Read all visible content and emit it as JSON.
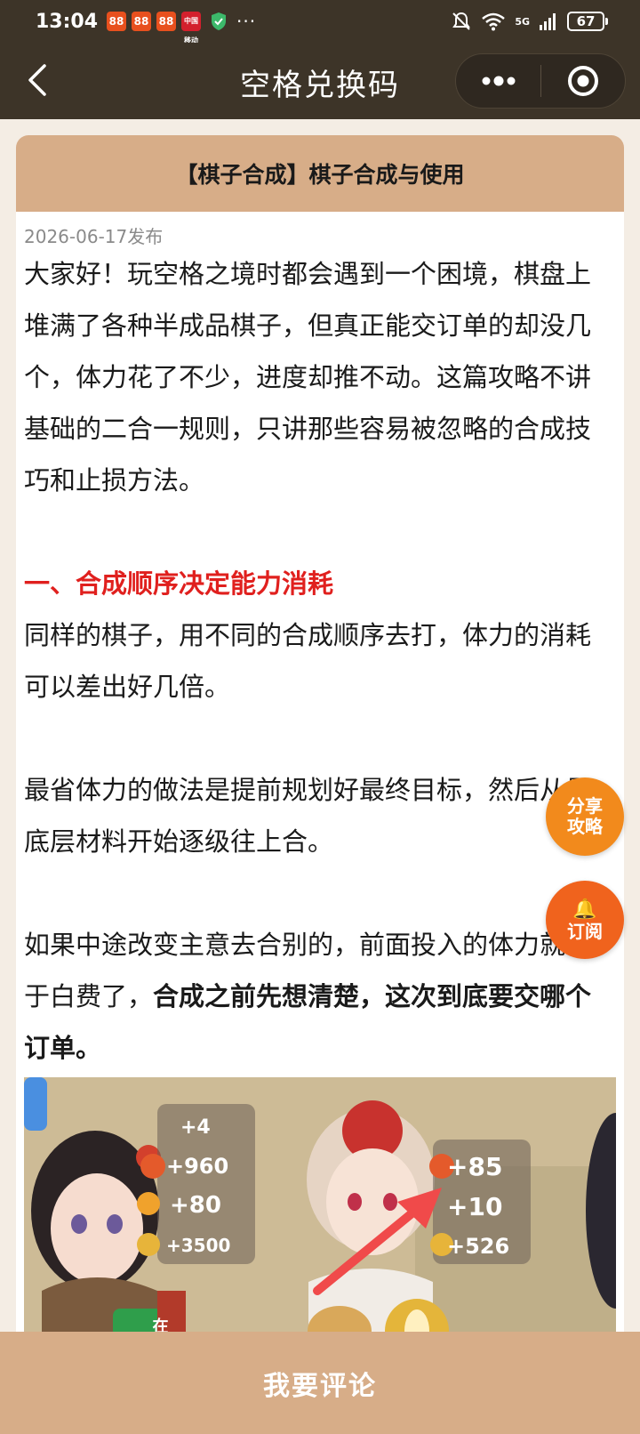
{
  "status_bar": {
    "time": "13:04",
    "app_icons": [
      "88",
      "88",
      "88",
      "中国移动"
    ],
    "more": "···",
    "network": "5G",
    "battery": "67"
  },
  "nav": {
    "title": "空格兑换码",
    "more_icon": "more-dots-icon",
    "close_icon": "target-close-icon"
  },
  "article": {
    "header": "【棋子合成】棋子合成与使用",
    "publish_date": "2026-06-17发布",
    "intro": "大家好！玩空格之境时都会遇到一个困境，棋盘上堆满了各种半成品棋子，但真正能交订单的却没几个，体力花了不少，进度却推不动。这篇攻略不讲基础的二合一规则，只讲那些容易被忽略的合成技巧和止损方法。",
    "section1_heading": "一、合成顺序决定能力消耗",
    "section1_p1": "同样的棋子，用不同的合成顺序去打，体力的消耗可以差出好几倍。",
    "section1_p2": "最省体力的做法是提前规划好最终目标，然后从最底层材料开始逐级往上合。",
    "section1_p3_normal": "如果中途改变主意去合别的，前面投入的体力就等于白费了，",
    "section1_p3_bold": "合成之前先想清楚，这次到底要交哪个订单。",
    "image_values_left": [
      "+4",
      "+960",
      "+80",
      "+3500"
    ],
    "image_values_right": [
      "+85",
      "+10",
      "+526"
    ],
    "image_badge": "在他"
  },
  "fab": {
    "share_line1": "分享",
    "share_line2": "攻略",
    "subscribe_label": "订阅"
  },
  "comment_button": "我要评论"
}
